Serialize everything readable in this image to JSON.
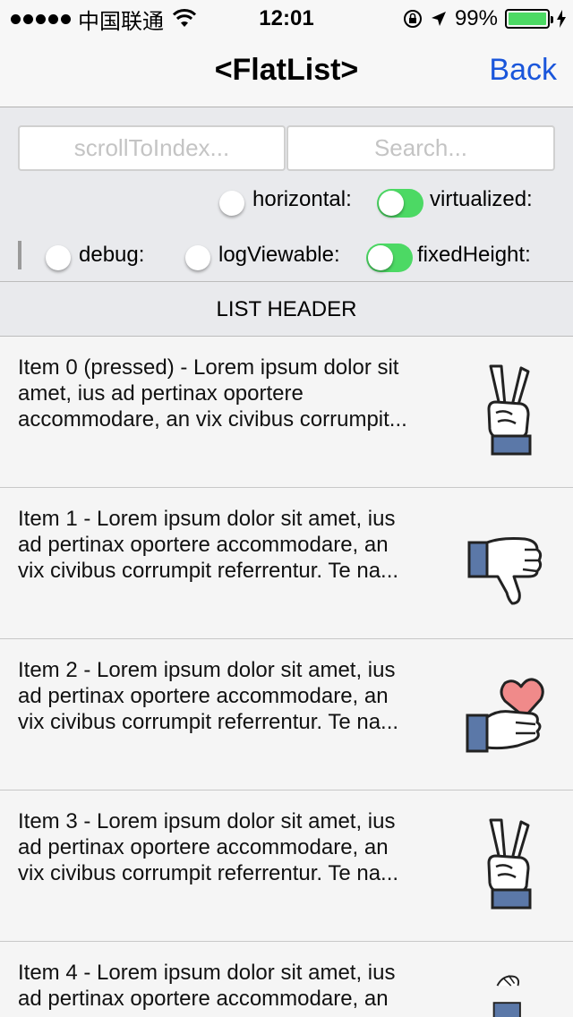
{
  "status_bar": {
    "carrier": "中国联通",
    "time": "12:01",
    "battery_percent": "99%",
    "battery_level": 0.99
  },
  "nav": {
    "title": "<FlatList>",
    "back_label": "Back"
  },
  "controls": {
    "scroll_placeholder": "scrollToIndex...",
    "search_placeholder": "Search...",
    "horizontal_label": "horizontal:",
    "virtualized_label": "virtualized:",
    "debug_label": "debug:",
    "log_viewable_label": "logViewable:",
    "fixed_height_label": "fixedHeight:",
    "horizontal_on": false,
    "virtualized_on": true,
    "debug_on": false,
    "log_viewable_on": false,
    "fixed_height_on": true
  },
  "list_header": "LIST HEADER",
  "items": [
    {
      "line1": "Item 0 (pressed) - Lorem ipsum dolor sit",
      "line2": "amet, ius ad pertinax oportere",
      "line3": "accommodare, an vix civibus corrumpit...",
      "icon": "victory-hand-icon"
    },
    {
      "line1": "Item 1 - Lorem ipsum dolor sit amet, ius",
      "line2": "ad pertinax oportere accommodare, an",
      "line3": "vix civibus corrumpit referrentur. Te na...",
      "icon": "thumbs-down-icon"
    },
    {
      "line1": "Item 2 - Lorem ipsum dolor sit amet, ius",
      "line2": "ad pertinax oportere accommodare, an",
      "line3": "vix civibus corrumpit referrentur. Te na...",
      "icon": "hand-heart-icon"
    },
    {
      "line1": "Item 3 - Lorem ipsum dolor sit amet, ius",
      "line2": "ad pertinax oportere accommodare, an",
      "line3": "vix civibus corrumpit referrentur. Te na...",
      "icon": "victory-hand-icon"
    },
    {
      "line1": "Item 4 - Lorem ipsum dolor sit amet, ius",
      "line2": "ad pertinax oportere accommodare, an",
      "line3": "",
      "icon": "bandaged-hand-icon"
    }
  ]
}
